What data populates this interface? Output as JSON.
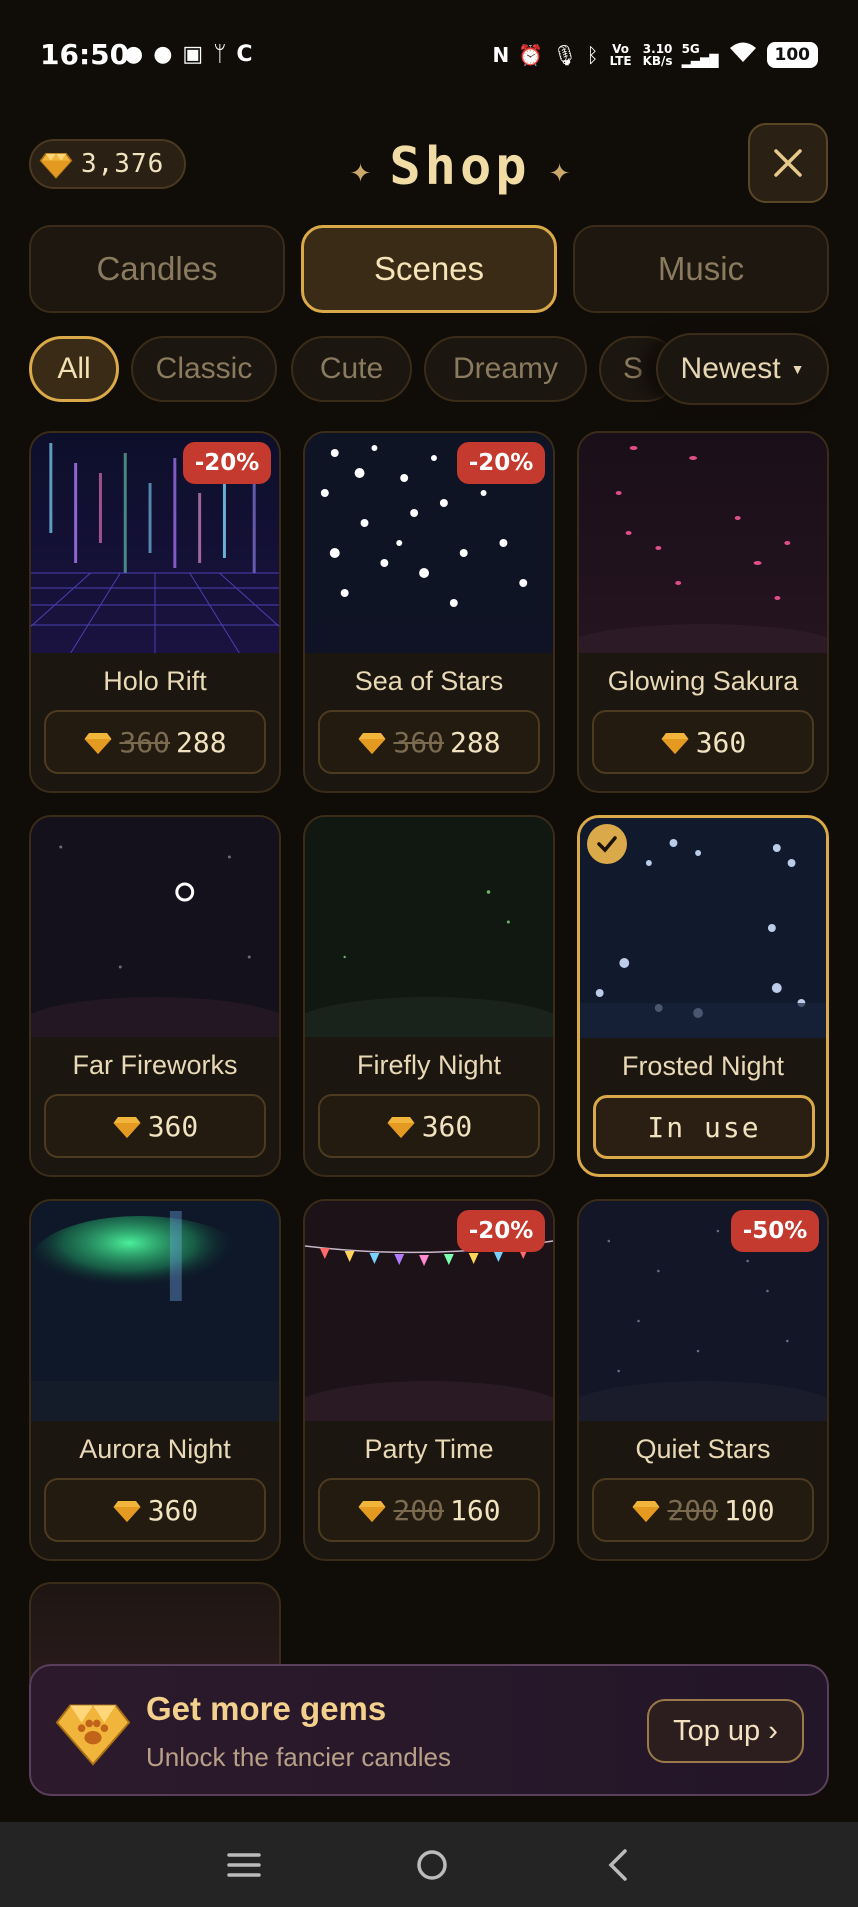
{
  "status_bar": {
    "time": "16:50",
    "left_icons": [
      "chat-bubble-icon",
      "line-icon",
      "clipboard-check-icon",
      "usb-icon",
      "c-app-icon"
    ],
    "right_icons": [
      "nfc-icon",
      "alarm-icon",
      "mic-icon",
      "bluetooth-icon",
      "volte-icon"
    ],
    "volte_label": "Vo LTE",
    "speed_value": "3.10",
    "speed_unit": "KB/s",
    "network": "5G",
    "battery": "100"
  },
  "header": {
    "gem_balance": "3,376",
    "title": "Shop",
    "close_icon": "close-icon"
  },
  "tabs": [
    {
      "label": "Candles",
      "active": false
    },
    {
      "label": "Scenes",
      "active": true
    },
    {
      "label": "Music",
      "active": false
    }
  ],
  "filters": [
    {
      "label": "All",
      "active": true
    },
    {
      "label": "Classic",
      "active": false
    },
    {
      "label": "Cute",
      "active": false
    },
    {
      "label": "Dreamy",
      "active": false
    },
    {
      "label": "S",
      "active": false
    }
  ],
  "sort": {
    "label": "Newest",
    "icon": "caret-down-icon"
  },
  "scenes": [
    {
      "name": "Holo Rift",
      "badge": "-20%",
      "old_price": "360",
      "price": "288",
      "state": "sale"
    },
    {
      "name": "Sea of Stars",
      "badge": "-20%",
      "old_price": "360",
      "price": "288",
      "state": "sale"
    },
    {
      "name": "Glowing Sakura",
      "badge": "",
      "old_price": "",
      "price": "360",
      "state": "buy"
    },
    {
      "name": "Far Fireworks",
      "badge": "",
      "old_price": "",
      "price": "360",
      "state": "buy"
    },
    {
      "name": "Firefly Night",
      "badge": "",
      "old_price": "",
      "price": "360",
      "state": "buy"
    },
    {
      "name": "Frosted Night",
      "badge": "",
      "old_price": "",
      "price": "",
      "state": "in_use",
      "action_label": "In use"
    },
    {
      "name": "Aurora Night",
      "badge": "",
      "old_price": "",
      "price": "360",
      "state": "buy"
    },
    {
      "name": "Party Time",
      "badge": "-20%",
      "old_price": "200",
      "price": "160",
      "state": "sale"
    },
    {
      "name": "Quiet Stars",
      "badge": "-50%",
      "old_price": "200",
      "price": "100",
      "state": "sale"
    }
  ],
  "banner": {
    "title": "Get more gems",
    "subtitle": "Unlock the fancier candles",
    "button": "Top up ›"
  },
  "colors": {
    "background": "#100c08",
    "accent_gold": "#d9a94a",
    "sale_red": "#c43a2e",
    "text_light": "#e9d9b6"
  }
}
